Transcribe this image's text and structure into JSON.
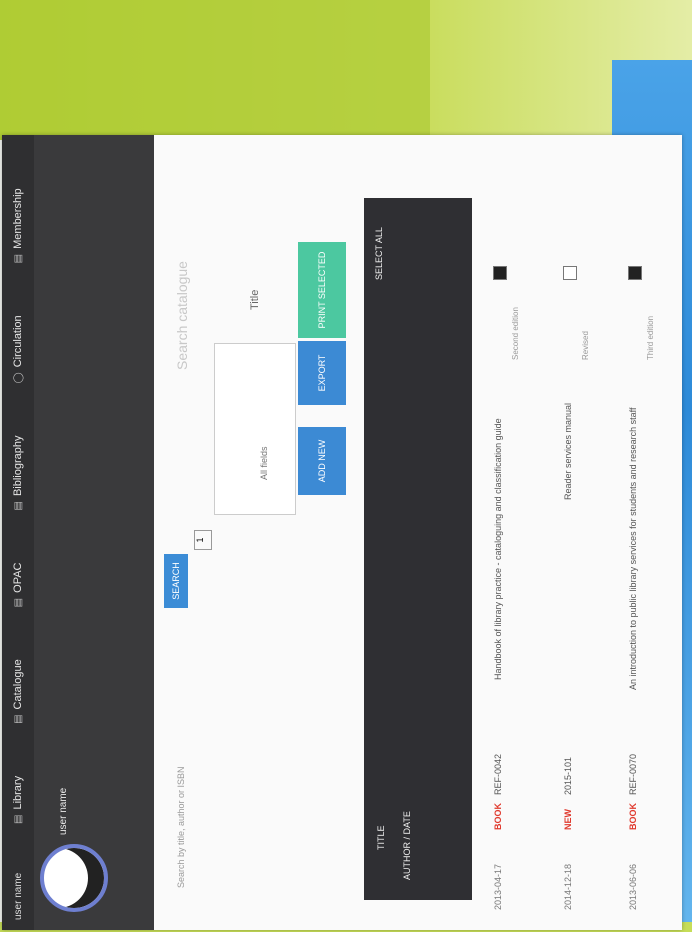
{
  "nav": {
    "user": "user name",
    "tabs": [
      {
        "label": "Library",
        "icon": "book-icon"
      },
      {
        "label": "Catalogue",
        "icon": "book-icon"
      },
      {
        "label": "OPAC",
        "icon": "book-icon"
      },
      {
        "label": "Bibliography",
        "icon": "book-icon"
      },
      {
        "label": "Circulation",
        "icon": "circle-icon"
      },
      {
        "label": "Membership",
        "icon": "book-icon"
      }
    ]
  },
  "search": {
    "hint": "Search by title, author or ISBN",
    "button": "SEARCH",
    "select_value": "1",
    "field_label": "Title",
    "toggle_label": "All fields",
    "heading": "Search catalogue"
  },
  "actions": {
    "buttons": [
      "ADD NEW",
      "EXPORT",
      "PRINT SELECTED"
    ]
  },
  "table": {
    "header_labels": [
      "SELECT ALL",
      "TITLE",
      "AUTHOR / DATE"
    ]
  },
  "rows": [
    {
      "checked": true,
      "title": "Handbook of library practice - cataloguing and classification guide",
      "subtitle": "Second edition",
      "date": "2013-04-17",
      "status": "BOOK",
      "code": "REF-0042"
    },
    {
      "checked": false,
      "title": "Reader services manual",
      "subtitle": "Revised",
      "date": "2014-12-18",
      "status": "NEW",
      "code": "2015-101"
    },
    {
      "checked": true,
      "title": "An introduction to public library services for students and research staff",
      "subtitle": "Third edition",
      "date": "2013-06-06",
      "status": "BOOK",
      "code": "REF-0070"
    }
  ]
}
